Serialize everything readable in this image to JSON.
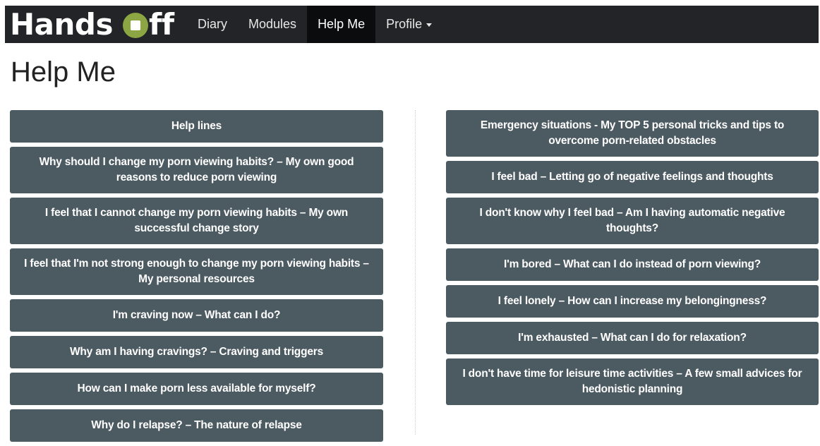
{
  "brand": {
    "text_before": "Hands",
    "text_after": "ff"
  },
  "nav": {
    "items": [
      {
        "label": "Diary"
      },
      {
        "label": "Modules"
      },
      {
        "label": "Help Me"
      },
      {
        "label": "Profile"
      }
    ]
  },
  "page": {
    "title": "Help Me"
  },
  "left_column": [
    {
      "label": "Help lines"
    },
    {
      "label": "Why should I change my porn viewing habits? – My own good reasons to reduce porn viewing"
    },
    {
      "label": "I feel that I cannot change my porn viewing habits – My own successful change story"
    },
    {
      "label": "I feel that I'm not strong enough to change my porn viewing habits – My personal resources"
    },
    {
      "label": "I'm craving now – What can I do?"
    },
    {
      "label": "Why am I having cravings? – Craving and triggers"
    },
    {
      "label": "How can I make porn less available for myself?"
    },
    {
      "label": "Why do I relapse? – The nature of relapse"
    }
  ],
  "right_column": [
    {
      "label": "Emergency situations - My TOP 5 personal tricks and tips to overcome porn-related obstacles"
    },
    {
      "label": "I feel bad – Letting go of negative feelings and thoughts"
    },
    {
      "label": "I don't know why I feel bad – Am I having automatic negative thoughts?"
    },
    {
      "label": "I'm bored – What can I do instead of porn viewing?"
    },
    {
      "label": "I feel lonely – How can I increase my belongingness?"
    },
    {
      "label": "I'm exhausted – What can I do for relaxation?"
    },
    {
      "label": "I don't have time for leisure time activities – A few small advices for hedonistic planning"
    }
  ],
  "colors": {
    "navbar": "#222427",
    "active_nav": "#0b0c0d",
    "button": "#4c5a62",
    "logo_accent": "#8ca644"
  }
}
